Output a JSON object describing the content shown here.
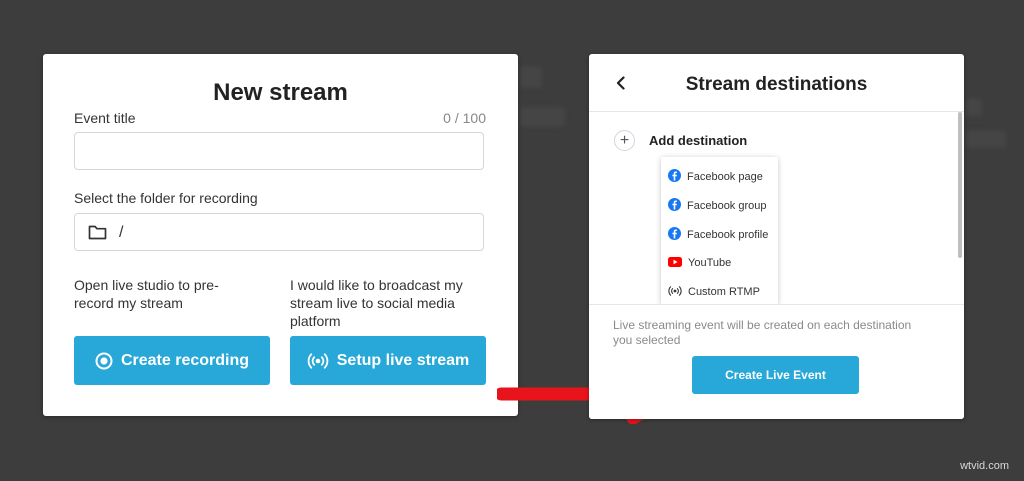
{
  "new_stream": {
    "title": "New stream",
    "event_title_label": "Event title",
    "event_title_counter": "0 / 100",
    "event_title_value": "",
    "folder_label": "Select the folder for recording",
    "folder_icon": "folder-icon",
    "folder_path": "/",
    "record_description": "Open live studio to pre-record my stream",
    "broadcast_description": "I would like to broadcast my stream live to social media platform",
    "create_recording_label": "Create recording",
    "setup_live_label": "Setup live stream"
  },
  "stream_destinations": {
    "title": "Stream destinations",
    "add_destination_label": "Add destination",
    "options": [
      {
        "label": "Facebook page",
        "icon": "facebook-icon"
      },
      {
        "label": "Facebook group",
        "icon": "facebook-icon"
      },
      {
        "label": "Facebook profile",
        "icon": "facebook-icon"
      },
      {
        "label": "YouTube",
        "icon": "youtube-icon"
      },
      {
        "label": "Custom RTMP",
        "icon": "broadcast-icon"
      }
    ],
    "note": "Live streaming event will be created on each destination you selected",
    "create_live_event_label": "Create Live Event"
  },
  "watermark": "wtvid.com",
  "colors": {
    "background": "#3d3d3d",
    "accent": "#27a8d8",
    "arrow": "#e8141c",
    "facebook": "#1877f2",
    "youtube": "#ff0000"
  }
}
